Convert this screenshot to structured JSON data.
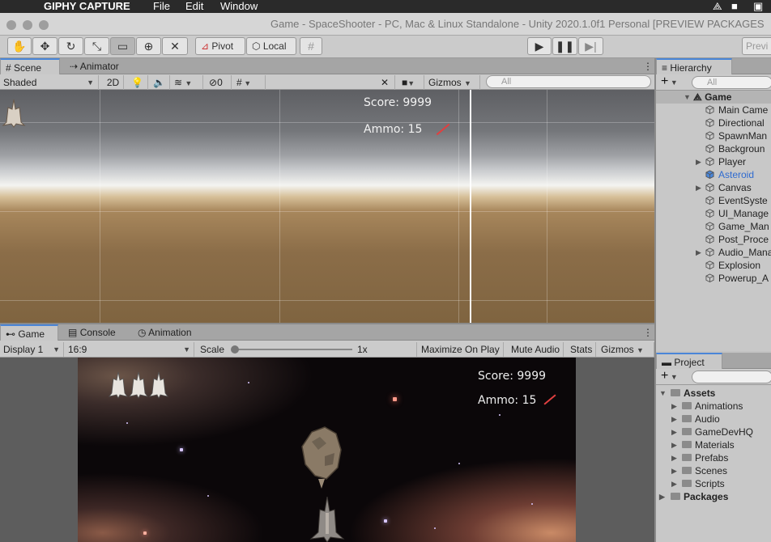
{
  "menubar": {
    "app": "GIPHY CAPTURE",
    "items": [
      "File",
      "Edit",
      "Window"
    ]
  },
  "window": {
    "title": "Game - SpaceShooter - PC, Mac & Linux Standalone - Unity 2020.1.0f1 Personal [PREVIEW PACKAGES"
  },
  "toolbar": {
    "pivot_label": "Pivot",
    "local_label": "Local",
    "preview_label": "Previ"
  },
  "scene_panel": {
    "tabs": [
      "Scene",
      "Animator"
    ],
    "shading_mode": "Shaded",
    "toggle_2d": "2D",
    "hidden_count": "0",
    "gizmos_label": "Gizmos",
    "search_placeholder": "All",
    "score_text": "Score: 9999",
    "ammo_text": "Ammo: 15"
  },
  "game_panel": {
    "tabs": [
      "Game",
      "Console",
      "Animation"
    ],
    "display": "Display 1",
    "aspect": "16:9",
    "scale_label": "Scale",
    "scale_value": "1x",
    "scale_level": 0.0,
    "buttons": [
      "Maximize On Play",
      "Mute Audio",
      "Stats",
      "Gizmos"
    ],
    "score_text": "Score: 9999",
    "ammo_text": "Ammo: 15"
  },
  "hierarchy": {
    "title": "Hierarchy",
    "search_placeholder": "All",
    "scene_name": "Game",
    "items": [
      {
        "label": "Main Came",
        "expandable": false,
        "selected": false
      },
      {
        "label": "Directional",
        "expandable": false,
        "selected": false
      },
      {
        "label": "SpawnMan",
        "expandable": false,
        "selected": false
      },
      {
        "label": "Backgroun",
        "expandable": false,
        "selected": false
      },
      {
        "label": "Player",
        "expandable": true,
        "selected": false
      },
      {
        "label": "Asteroid",
        "expandable": false,
        "selected": true
      },
      {
        "label": "Canvas",
        "expandable": true,
        "selected": false
      },
      {
        "label": "EventSyste",
        "expandable": false,
        "selected": false
      },
      {
        "label": "UI_Manage",
        "expandable": false,
        "selected": false
      },
      {
        "label": "Game_Man",
        "expandable": false,
        "selected": false
      },
      {
        "label": "Post_Proce",
        "expandable": false,
        "selected": false
      },
      {
        "label": "Audio_Mana",
        "expandable": true,
        "selected": false
      },
      {
        "label": "Explosion",
        "expandable": false,
        "selected": false
      },
      {
        "label": "Powerup_A",
        "expandable": false,
        "selected": false
      }
    ]
  },
  "project": {
    "title": "Project",
    "root": "Assets",
    "folders": [
      "Animations",
      "Audio",
      "GameDevHQ",
      "Materials",
      "Prefabs",
      "Scenes",
      "Scripts"
    ],
    "packages": "Packages"
  },
  "colors": {
    "selected_text": "#2f6bd0",
    "tab_accent": "#4a86d8",
    "laser": "#e04040"
  }
}
